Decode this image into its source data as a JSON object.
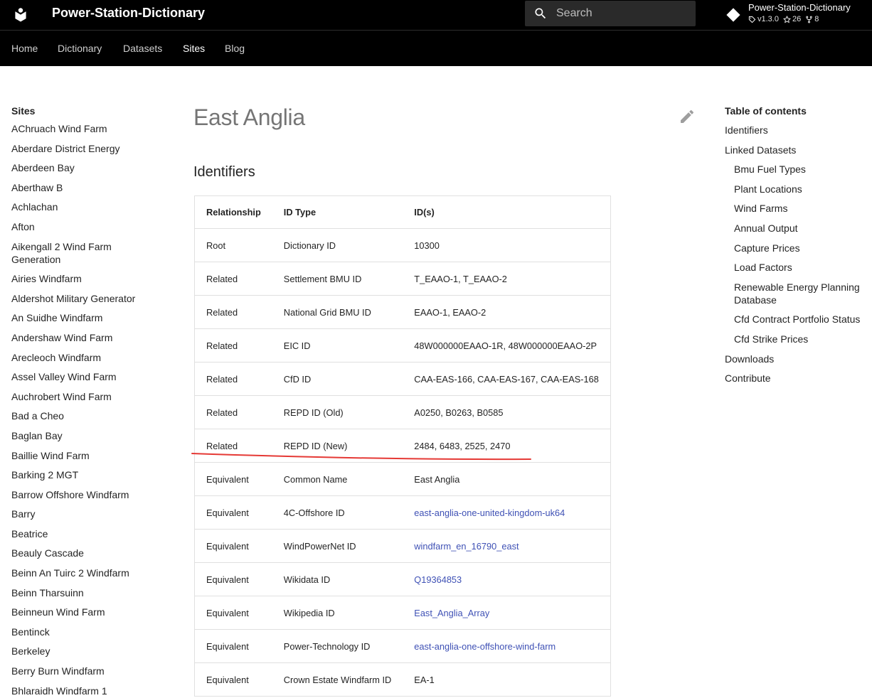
{
  "header": {
    "title": "Power-Station-Dictionary",
    "search_placeholder": "Search",
    "repo": {
      "name": "Power-Station-Dictionary",
      "version": "v1.3.0",
      "stars": "26",
      "forks": "8"
    }
  },
  "tabs": [
    {
      "label": "Home",
      "active": false
    },
    {
      "label": "Dictionary",
      "active": false
    },
    {
      "label": "Datasets",
      "active": false
    },
    {
      "label": "Sites",
      "active": true
    },
    {
      "label": "Blog",
      "active": false
    }
  ],
  "nav": {
    "title": "Sites",
    "items": [
      "AChruach Wind Farm",
      "Aberdare District Energy",
      "Aberdeen Bay",
      "Aberthaw B",
      "Achlachan",
      "Afton",
      "Aikengall 2 Wind Farm Generation",
      "Airies Windfarm",
      "Aldershot Military Generator",
      "An Suidhe Windfarm",
      "Andershaw Wind Farm",
      "Arecleoch Windfarm",
      "Assel Valley Wind Farm",
      "Auchrobert Wind Farm",
      "Bad a Cheo",
      "Baglan Bay",
      "Baillie Wind Farm",
      "Barking 2 MGT",
      "Barrow Offshore Windfarm",
      "Barry",
      "Beatrice",
      "Beauly Cascade",
      "Beinn An Tuirc 2 Windfarm",
      "Beinn Tharsuinn",
      "Beinneun Wind Farm",
      "Bentinck",
      "Berkeley",
      "Berry Burn Windfarm",
      "Bhlaraidh Windfarm 1"
    ]
  },
  "main": {
    "title": "East Anglia",
    "section": "Identifiers",
    "columns": [
      "Relationship",
      "ID Type",
      "ID(s)"
    ],
    "rows": [
      {
        "relationship": "Root",
        "id_type": "Dictionary ID",
        "ids": "10300",
        "link": false
      },
      {
        "relationship": "Related",
        "id_type": "Settlement BMU ID",
        "ids": "T_EAAO-1, T_EAAO-2",
        "link": false
      },
      {
        "relationship": "Related",
        "id_type": "National Grid BMU ID",
        "ids": "EAAO-1, EAAO-2",
        "link": false
      },
      {
        "relationship": "Related",
        "id_type": "EIC ID",
        "ids": "48W000000EAAO-1R, 48W000000EAAO-2P",
        "link": false
      },
      {
        "relationship": "Related",
        "id_type": "CfD ID",
        "ids": "CAA-EAS-166, CAA-EAS-167, CAA-EAS-168",
        "link": false
      },
      {
        "relationship": "Related",
        "id_type": "REPD ID (Old)",
        "ids": "A0250, B0263, B0585",
        "link": false
      },
      {
        "relationship": "Related",
        "id_type": "REPD ID (New)",
        "ids": "2484, 6483, 2525, 2470",
        "link": false
      },
      {
        "relationship": "Equivalent",
        "id_type": "Common Name",
        "ids": "East Anglia",
        "link": false
      },
      {
        "relationship": "Equivalent",
        "id_type": "4C-Offshore ID",
        "ids": "east-anglia-one-united-kingdom-uk64",
        "link": true
      },
      {
        "relationship": "Equivalent",
        "id_type": "WindPowerNet ID",
        "ids": "windfarm_en_16790_east",
        "link": true
      },
      {
        "relationship": "Equivalent",
        "id_type": "Wikidata ID",
        "ids": "Q19364853",
        "link": true
      },
      {
        "relationship": "Equivalent",
        "id_type": "Wikipedia ID",
        "ids": "East_Anglia_Array",
        "link": true
      },
      {
        "relationship": "Equivalent",
        "id_type": "Power-Technology ID",
        "ids": "east-anglia-one-offshore-wind-farm",
        "link": true
      },
      {
        "relationship": "Equivalent",
        "id_type": "Crown Estate Windfarm ID",
        "ids": "EA-1",
        "link": false
      }
    ]
  },
  "toc": {
    "title": "Table of contents",
    "items": [
      {
        "label": "Identifiers",
        "level": 1
      },
      {
        "label": "Linked Datasets",
        "level": 1
      },
      {
        "label": "Bmu Fuel Types",
        "level": 2
      },
      {
        "label": "Plant Locations",
        "level": 2
      },
      {
        "label": "Wind Farms",
        "level": 2
      },
      {
        "label": "Annual Output",
        "level": 2
      },
      {
        "label": "Capture Prices",
        "level": 2
      },
      {
        "label": "Load Factors",
        "level": 2
      },
      {
        "label": "Renewable Energy Planning Database",
        "level": 2
      },
      {
        "label": "Cfd Contract Portfolio Status",
        "level": 2
      },
      {
        "label": "Cfd Strike Prices",
        "level": 2
      },
      {
        "label": "Downloads",
        "level": 1
      },
      {
        "label": "Contribute",
        "level": 1
      }
    ]
  },
  "colors": {
    "header_bg": "#000000",
    "link": "#3f51b5",
    "annotation": "#e53935",
    "title_grey": "#757575"
  },
  "icons": {
    "logo": "book-icon",
    "search": "search-icon",
    "repo": "git-icon",
    "edit": "pencil-icon"
  }
}
